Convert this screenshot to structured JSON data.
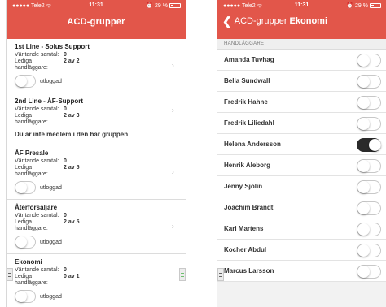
{
  "left": {
    "status": {
      "carrier": "●●●●● Tele2 ᯤ",
      "time": "11:31",
      "battery": "29 %",
      "alarm": "⏰"
    },
    "title": "ACD-grupper",
    "groups": [
      {
        "name": "1st Line - Solus Support",
        "waiting_label": "Väntande samtal:",
        "waiting": "0",
        "free_label": "Lediga handläggare:",
        "free": "2 av 2",
        "member": true,
        "toggle_label": "utloggad"
      },
      {
        "name": "2nd Line - ÅF-Support",
        "waiting_label": "Väntande samtal:",
        "waiting": "0",
        "free_label": "Lediga handläggare:",
        "free": "2 av 3",
        "member": false,
        "note": "Du är inte medlem i den här gruppen"
      },
      {
        "name": "ÅF Presale",
        "waiting_label": "Väntande samtal:",
        "waiting": "0",
        "free_label": "Lediga handläggare:",
        "free": "2 av 5",
        "member": true,
        "toggle_label": "utloggad"
      },
      {
        "name": "Återförsäljare",
        "waiting_label": "Väntande samtal:",
        "waiting": "0",
        "free_label": "Lediga handläggare:",
        "free": "2 av 5",
        "member": true,
        "toggle_label": "utloggad"
      },
      {
        "name": "Ekonomi",
        "waiting_label": "Väntande samtal:",
        "waiting": "0",
        "free_label": "Lediga handläggare:",
        "free": "0 av 1",
        "member": true,
        "toggle_label": "utloggad"
      }
    ]
  },
  "right": {
    "status": {
      "carrier": "●●●●● Tele2 ᯤ",
      "time": "11:31",
      "battery": "29 %",
      "alarm": "⏰"
    },
    "back_label": "ACD-grupper",
    "title": "Ekonomi",
    "section": "HANDLÄGGARE",
    "people": [
      {
        "name": "Amanda Tuvhag",
        "on": false
      },
      {
        "name": "Bella Sundwall",
        "on": false
      },
      {
        "name": "Fredrik Hahne",
        "on": false
      },
      {
        "name": "Fredrik Liliedahl",
        "on": false
      },
      {
        "name": "Helena Andersson",
        "on": true
      },
      {
        "name": "Henrik Aleborg",
        "on": false
      },
      {
        "name": "Jenny Sjölin",
        "on": false
      },
      {
        "name": "Joachim Brandt",
        "on": false
      },
      {
        "name": "Kari Martens",
        "on": false
      },
      {
        "name": "Kocher Abdul",
        "on": false
      },
      {
        "name": "Marcus Larsson",
        "on": false
      }
    ]
  },
  "colors": {
    "accent": "#e2564a",
    "toggle_on": "#2a2a2a",
    "handle_green": "#6fbf6f"
  },
  "icons": {
    "chevron_right": "›",
    "chevron_left": "❮"
  }
}
